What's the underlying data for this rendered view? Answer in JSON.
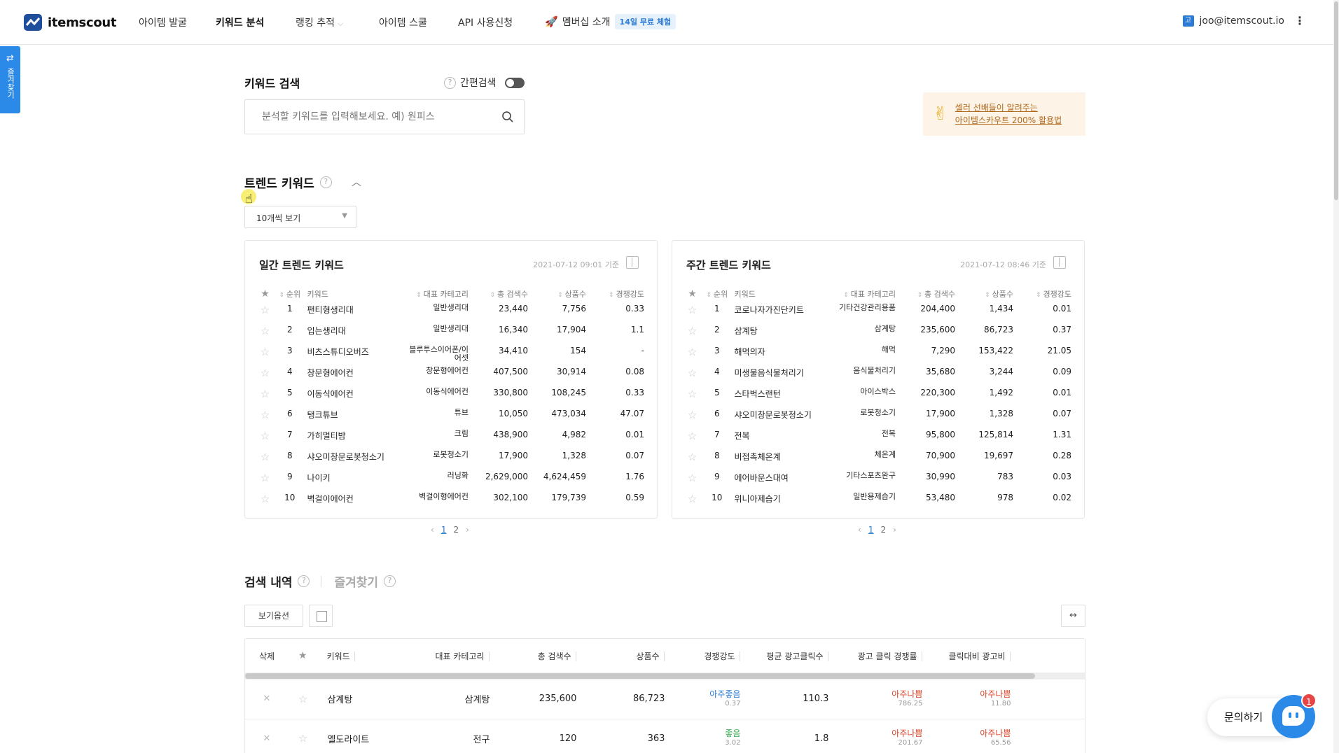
{
  "nav": {
    "logo_text": "itemscout",
    "items": [
      {
        "label": "아이템 발굴"
      },
      {
        "label": "키워드 분석"
      },
      {
        "label": "랭킹 추적"
      },
      {
        "label": "아이템 스쿨"
      },
      {
        "label": "API 사용신청"
      }
    ],
    "membership_label": "멤버십 소개",
    "trial_badge": "14일 무료 체험",
    "user_avatar": "고",
    "user_email": "joo@itemscout.io",
    "kebab": "⋮",
    "active_color": "#111111"
  },
  "side_tab": {
    "label": "즐겨찾기",
    "arrows": "⇄"
  },
  "search": {
    "title": "키워드 검색",
    "simple_search_label": "간편검색",
    "placeholder": "분석할 키워드를 입력해보세요. 예) 원피스",
    "help": "?"
  },
  "promo": {
    "emoji": "✌",
    "line1": "셀러 선배들이 알려주는",
    "line2": "아이템스카우트 200% 활용법"
  },
  "trend": {
    "title": "트렌드 키워드",
    "help": "?",
    "view_select": "10개씩 보기",
    "columns": {
      "rank": "순위",
      "keyword": "키워드",
      "category": "대표 카테고리",
      "searches": "총 검색수",
      "products": "상품수",
      "competition": "경쟁강도"
    },
    "daily": {
      "title": "일간 트렌드 키워드",
      "date": "2021-07-12 09:01 기준",
      "rows": [
        {
          "rank": "1",
          "keyword": "팬티형생리대",
          "category": "일반생리대",
          "searches": "23,440",
          "products": "7,756",
          "competition": "0.33"
        },
        {
          "rank": "2",
          "keyword": "입는생리대",
          "category": "일반생리대",
          "searches": "16,340",
          "products": "17,904",
          "competition": "1.1"
        },
        {
          "rank": "3",
          "keyword": "비츠스튜디오버즈",
          "category": "블루투스이어폰/이어셋",
          "searches": "34,410",
          "products": "154",
          "competition": "-"
        },
        {
          "rank": "4",
          "keyword": "창문형에어컨",
          "category": "창문형에어컨",
          "searches": "407,500",
          "products": "30,914",
          "competition": "0.08"
        },
        {
          "rank": "5",
          "keyword": "이동식에어컨",
          "category": "이동식에어컨",
          "searches": "330,800",
          "products": "108,245",
          "competition": "0.33"
        },
        {
          "rank": "6",
          "keyword": "탱크튜브",
          "category": "튜브",
          "searches": "10,050",
          "products": "473,034",
          "competition": "47.07"
        },
        {
          "rank": "7",
          "keyword": "가히멀티밤",
          "category": "크림",
          "searches": "438,900",
          "products": "4,982",
          "competition": "0.01"
        },
        {
          "rank": "8",
          "keyword": "샤오미창문로봇청소기",
          "category": "로봇청소기",
          "searches": "17,900",
          "products": "1,328",
          "competition": "0.07"
        },
        {
          "rank": "9",
          "keyword": "나이키",
          "category": "러닝화",
          "searches": "2,629,000",
          "products": "4,624,459",
          "competition": "1.76"
        },
        {
          "rank": "10",
          "keyword": "벽걸이에어컨",
          "category": "벽걸이형에어컨",
          "searches": "302,100",
          "products": "179,739",
          "competition": "0.59"
        }
      ],
      "pages": [
        "1",
        "2"
      ]
    },
    "weekly": {
      "title": "주간 트렌드 키워드",
      "date": "2021-07-12 08:46 기준",
      "rows": [
        {
          "rank": "1",
          "keyword": "코로나자가진단키트",
          "category": "기타건강관리용품",
          "searches": "204,400",
          "products": "1,434",
          "competition": "0.01"
        },
        {
          "rank": "2",
          "keyword": "삼계탕",
          "category": "삼계탕",
          "searches": "235,600",
          "products": "86,723",
          "competition": "0.37"
        },
        {
          "rank": "3",
          "keyword": "해먹의자",
          "category": "해먹",
          "searches": "7,290",
          "products": "153,422",
          "competition": "21.05"
        },
        {
          "rank": "4",
          "keyword": "미생물음식물처리기",
          "category": "음식물처리기",
          "searches": "35,680",
          "products": "3,244",
          "competition": "0.09"
        },
        {
          "rank": "5",
          "keyword": "스타벅스랜턴",
          "category": "아이스박스",
          "searches": "220,300",
          "products": "1,492",
          "competition": "0.01"
        },
        {
          "rank": "6",
          "keyword": "샤오미창문로봇청소기",
          "category": "로봇청소기",
          "searches": "17,900",
          "products": "1,328",
          "competition": "0.07"
        },
        {
          "rank": "7",
          "keyword": "전복",
          "category": "전복",
          "searches": "95,800",
          "products": "125,814",
          "competition": "1.31"
        },
        {
          "rank": "8",
          "keyword": "비접촉체온계",
          "category": "체온계",
          "searches": "70,900",
          "products": "19,697",
          "competition": "0.28"
        },
        {
          "rank": "9",
          "keyword": "에어바운스대여",
          "category": "기타스포츠완구",
          "searches": "30,990",
          "products": "783",
          "competition": "0.03"
        },
        {
          "rank": "10",
          "keyword": "위니아제습기",
          "category": "일반용제습기",
          "searches": "53,480",
          "products": "978",
          "competition": "0.02"
        }
      ],
      "pages": [
        "1",
        "2"
      ]
    }
  },
  "history": {
    "tab_history": "검색 내역",
    "tab_favorites": "즐겨찾기",
    "view_options": "보기옵션",
    "expand": "↔",
    "columns": {
      "delete": "삭제",
      "keyword": "키워드",
      "category": "대표 카테고리",
      "searches": "총 검색수",
      "products": "상품수",
      "competition": "경쟁강도",
      "avg_clicks": "평균 광고클릭수",
      "click_competition": "광고 클릭 경쟁률",
      "cost_per_click": "클릭대비 광고비"
    },
    "rows": [
      {
        "keyword": "삼계탕",
        "category": "삼계탕",
        "searches": "235,600",
        "products": "86,723",
        "competition": {
          "label": "아주좋음",
          "value": "0.37"
        },
        "avg_clicks": "110.3",
        "click_competition": {
          "label": "아주나쁨",
          "value": "786.25"
        },
        "cost_per_click": {
          "label": "아주나쁨",
          "value": "11.80"
        }
      },
      {
        "keyword": "옐도라이트",
        "category": "전구",
        "searches": "120",
        "products": "363",
        "competition": {
          "label": "좋음",
          "value": "3.02"
        },
        "avg_clicks": "1.8",
        "click_competition": {
          "label": "아주나쁨",
          "value": "201.67"
        },
        "cost_per_click": {
          "label": "아주나쁨",
          "value": "65.56"
        }
      }
    ]
  },
  "chat": {
    "label": "문의하기",
    "badge": "1"
  },
  "colors": {
    "brand": "#1f4e9c",
    "accent": "#2b8ae8",
    "good": "#2a7ad6",
    "ok": "#2ea84e",
    "bad": "#d9462a",
    "promo_bg": "#fdf3e7"
  }
}
